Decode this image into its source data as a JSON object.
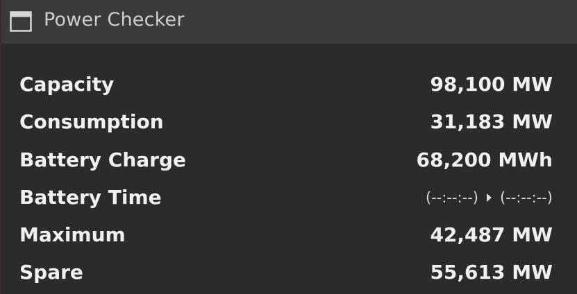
{
  "window": {
    "title": "Power Checker",
    "icon": "window-icon"
  },
  "stats": [
    {
      "label": "Capacity",
      "value": "98,100 MW"
    },
    {
      "label": "Consumption",
      "value": "31,183 MW"
    },
    {
      "label": "Battery Charge",
      "value": "68,200 MWh"
    },
    {
      "label": "Battery Time",
      "time_from": "(--:--:--)",
      "time_to": "(--:--:--)"
    },
    {
      "label": "Maximum",
      "value": "42,487 MW"
    },
    {
      "label": "Spare",
      "value": "55,613 MW"
    }
  ],
  "colors": {
    "background": "#2b2b2b",
    "titlebar": "#3a3a3a",
    "text": "#f0f0f0"
  }
}
